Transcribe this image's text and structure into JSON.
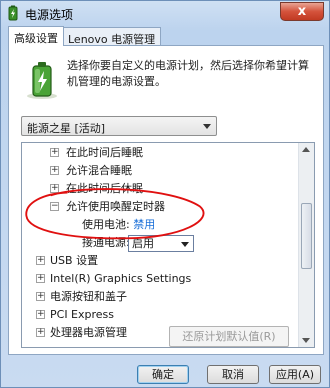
{
  "window": {
    "title": "电源选项",
    "close_glyph": "x"
  },
  "tabs": [
    {
      "label": "高级设置",
      "active": true
    },
    {
      "label": "Lenovo 电源管理",
      "active": false
    }
  ],
  "description": "选择你要自定义的电源计划，然后选择你希望计算机管理的电源设置。",
  "plan_select": {
    "value": "能源之星 [活动]"
  },
  "tree": {
    "items": [
      {
        "label": "在此时间后睡眠",
        "expander": "+"
      },
      {
        "label": "允许混合睡眠",
        "expander": "+"
      },
      {
        "label": "在此时间后休眠",
        "expander": "+"
      },
      {
        "label": "允许使用唤醒定时器",
        "expander": "−"
      },
      {
        "label": "USB 设置",
        "expander": "+"
      },
      {
        "label": "Intel(R) Graphics Settings",
        "expander": "+"
      },
      {
        "label": "电源按钮和盖子",
        "expander": "+"
      },
      {
        "label": "PCI Express",
        "expander": "+"
      },
      {
        "label": "处理器电源管理",
        "expander": "+"
      }
    ],
    "sub_settings": [
      {
        "label": "使用电池:",
        "value": "禁用"
      },
      {
        "label": "接通电源:",
        "value": "启用"
      }
    ]
  },
  "restore_button": "还原计划默认值(R)",
  "buttons": {
    "ok": "确定",
    "cancel": "取消",
    "apply": "应用(A)"
  },
  "colors": {
    "link_value": "#1a6fd8",
    "annotation": "#e01010"
  }
}
